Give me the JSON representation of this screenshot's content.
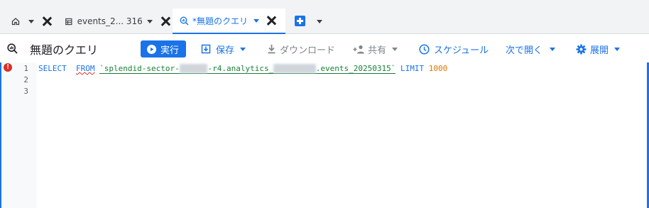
{
  "tabs": [
    {
      "label": "events_2... 316",
      "icon": "table-icon"
    },
    {
      "label": "*無題のクエリ",
      "icon": "query-icon",
      "active": true
    }
  ],
  "toolbar": {
    "title": "無題のクエリ",
    "run_label": "実行",
    "save_label": "保存",
    "download_label": "ダウンロード",
    "share_label": "共有",
    "schedule_label": "スケジュール",
    "open_label": "次で開く",
    "deploy_label": "展開"
  },
  "editor": {
    "line_numbers": [
      "1",
      "2",
      "3"
    ],
    "code": {
      "select": "SELECT",
      "from": "FROM",
      "table_part1": "`splendid-sector-",
      "table_redacted1": "xxxxxx",
      "table_part2": "-r4.analytics_",
      "table_redacted2": "xxxxxxxxx",
      "table_part3": ".events_20250315`",
      "limit": "LIMIT",
      "limit_value": "1000"
    }
  },
  "colors": {
    "accent": "#1a73e8",
    "error": "#d93025",
    "table": "#188038",
    "number": "#e37400"
  }
}
